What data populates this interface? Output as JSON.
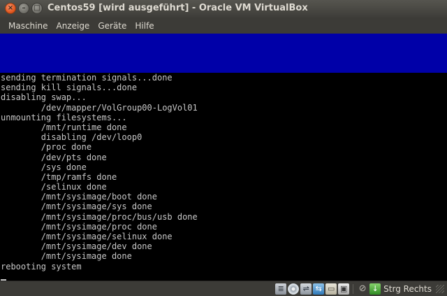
{
  "window": {
    "title": "Centos59 [wird ausgeführt] - Oracle VM VirtualBox",
    "controls": {
      "close_glyph": "×",
      "minimize_glyph": "–",
      "maximize_glyph": "□"
    }
  },
  "menubar": {
    "items": [
      "Maschine",
      "Anzeige",
      "Geräte",
      "Hilfe"
    ]
  },
  "vm_screen": {
    "banner_color": "#0000a8",
    "console_lines": [
      "sending termination signals...done",
      "sending kill signals...done",
      "disabling swap...",
      "        /dev/mapper/VolGroup00-LogVol01",
      "unmounting filesystems...",
      "        /mnt/runtime done",
      "        disabling /dev/loop0",
      "        /proc done",
      "        /dev/pts done",
      "        /sys done",
      "        /tmp/ramfs done",
      "        /selinux done",
      "        /mnt/sysimage/boot done",
      "        /mnt/sysimage/sys done",
      "        /mnt/sysimage/proc/bus/usb done",
      "        /mnt/sysimage/proc done",
      "        /mnt/sysimage/selinux done",
      "        /mnt/sysimage/dev done",
      "        /mnt/sysimage done",
      "rebooting system"
    ]
  },
  "statusbar": {
    "icons": [
      {
        "name": "hard-disk-icon",
        "glyph": "≣"
      },
      {
        "name": "optical-drive-icon",
        "glyph": "●"
      },
      {
        "name": "usb-icon",
        "glyph": "⇌"
      },
      {
        "name": "network-icon",
        "glyph": "⇆"
      },
      {
        "name": "shared-folders-icon",
        "glyph": "▭"
      },
      {
        "name": "display-icon",
        "glyph": "▣"
      },
      {
        "name": "mouse-integration-icon",
        "glyph": "⊘"
      },
      {
        "name": "keyboard-capture-icon",
        "glyph": "↓"
      }
    ],
    "host_key": "Strg Rechts"
  }
}
